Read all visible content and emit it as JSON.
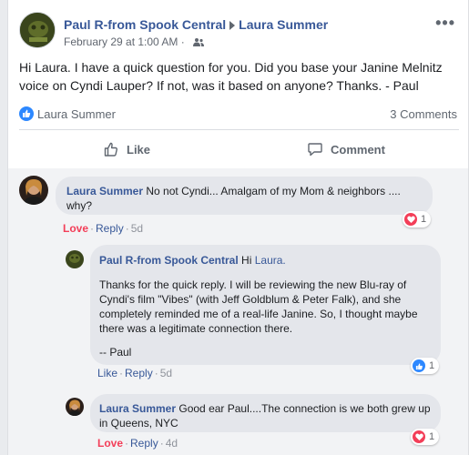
{
  "post": {
    "author": "Paul R-from Spook Central",
    "recipient": "Laura Summer",
    "timestamp": "February 29 at 1:00 AM",
    "privacy_icon": "friends-icon",
    "more_label": "•••",
    "text": "Hi Laura. I have a quick question for you. Did you base your Janine Melnitz voice on Cyndi Lauper? If not, was it based on anyone? Thanks. - Paul",
    "reactor_name": "Laura Summer",
    "comments_count": "3 Comments",
    "like_label": "Like",
    "comment_label": "Comment"
  },
  "comments": [
    {
      "author": "Laura Summer",
      "text": "No not Cyndi... Amalgam of my Mom & neighbors .... why?",
      "reaction_label": "Love",
      "reply_label": "Reply",
      "time": "5d",
      "reaction_count": "1",
      "reaction_icon": "heart-icon"
    },
    {
      "author": "Paul R-from Spook Central",
      "greeting": "Hi",
      "mention": "Laura.",
      "para1": "Thanks for the quick reply. I will be reviewing the new Blu-ray of Cyndi's film \"Vibes\" (with Jeff Goldblum & Peter Falk), and she completely reminded me of a real-life Janine. So, I thought maybe there was a legitimate connection there.",
      "para2": "-- Paul",
      "reaction_label": "Like",
      "reply_label": "Reply",
      "time": "5d",
      "reaction_count": "1",
      "reaction_icon": "thumbs-up-icon"
    },
    {
      "author": "Laura Summer",
      "text": "Good ear Paul....The connection is we both grew up in Queens, NYC",
      "reaction_label": "Love",
      "reply_label": "Reply",
      "time": "4d",
      "reaction_count": "1",
      "reaction_icon": "heart-icon"
    }
  ],
  "colors": {
    "link": "#385898",
    "love": "#f33e58",
    "like_blue": "#2d88ff",
    "bubble": "#e4e6eb"
  }
}
